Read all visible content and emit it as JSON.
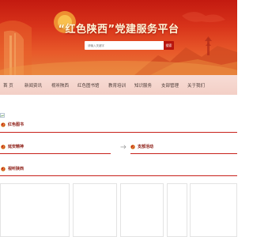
{
  "banner": {
    "title": "“红色陕西”党建服务平台",
    "search_placeholder": "请输入关键字",
    "search_button": "搜索"
  },
  "nav": {
    "items": [
      {
        "label": "首 页"
      },
      {
        "label": "新闻资讯"
      },
      {
        "label": "视听陕西"
      },
      {
        "label": "红色图书馆"
      },
      {
        "label": "教育培训"
      },
      {
        "label": "知识服务"
      },
      {
        "label": "支部管理"
      },
      {
        "label": "关于我们"
      }
    ]
  },
  "sections": {
    "red_library": "红色图书",
    "spirit": "延安精神",
    "activities": "支部活动",
    "audio_video": "视听陕西"
  },
  "colors": {
    "brand_red": "#c7211a",
    "nav_bg": "#f5d6ce",
    "title_text": "#fff6d8"
  },
  "icons": [
    "party-emblem-icon",
    "broken-image-icon",
    "arrow-right-icon"
  ]
}
